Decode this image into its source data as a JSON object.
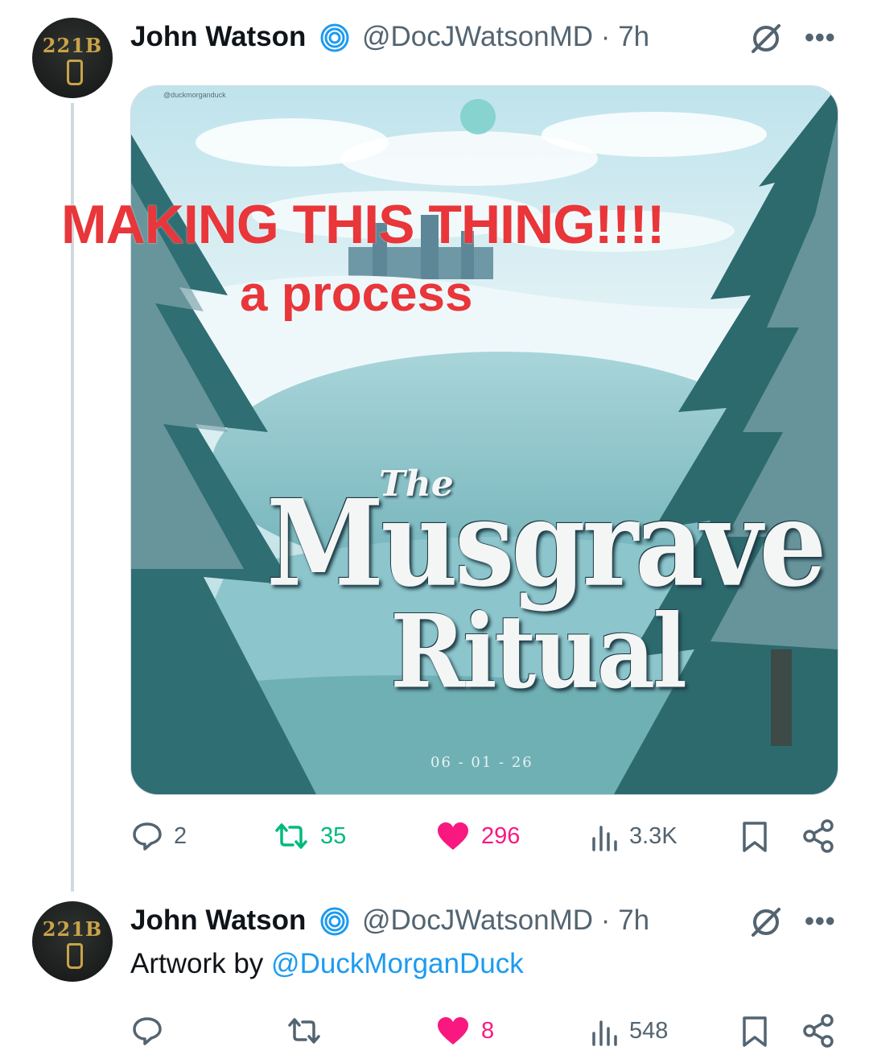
{
  "colors": {
    "text_primary": "#0f1419",
    "text_secondary": "#536471",
    "link": "#1d9bf0",
    "retweet": "#00ba7c",
    "like": "#f91880",
    "overlay_red": "#e8363a"
  },
  "tweet": {
    "avatar_text": "221B",
    "author_name": "John Watson",
    "handle": "@DocJWatsonMD",
    "separator": "·",
    "time": "7h",
    "more_label": "•••",
    "media": {
      "watermark": "@duckmorganduck",
      "overlay_line1": "MAKING THIS THING!!!!",
      "overlay_line2": "a process",
      "title_the": "The",
      "title_main": "Musgrave",
      "title_sub": "Ritual",
      "date": "06 - 01 - 26"
    },
    "actions": {
      "reply_count": "2",
      "retweet_count": "35",
      "like_count": "296",
      "views_count": "3.3K"
    }
  },
  "reply": {
    "avatar_text": "221B",
    "author_name": "John Watson",
    "handle": "@DocJWatsonMD",
    "separator": "·",
    "time": "7h",
    "more_label": "•••",
    "text_prefix": "Artwork by ",
    "mention": "@DuckMorganDuck",
    "actions": {
      "reply_count": "",
      "retweet_count": "",
      "like_count": "8",
      "views_count": "548"
    }
  }
}
